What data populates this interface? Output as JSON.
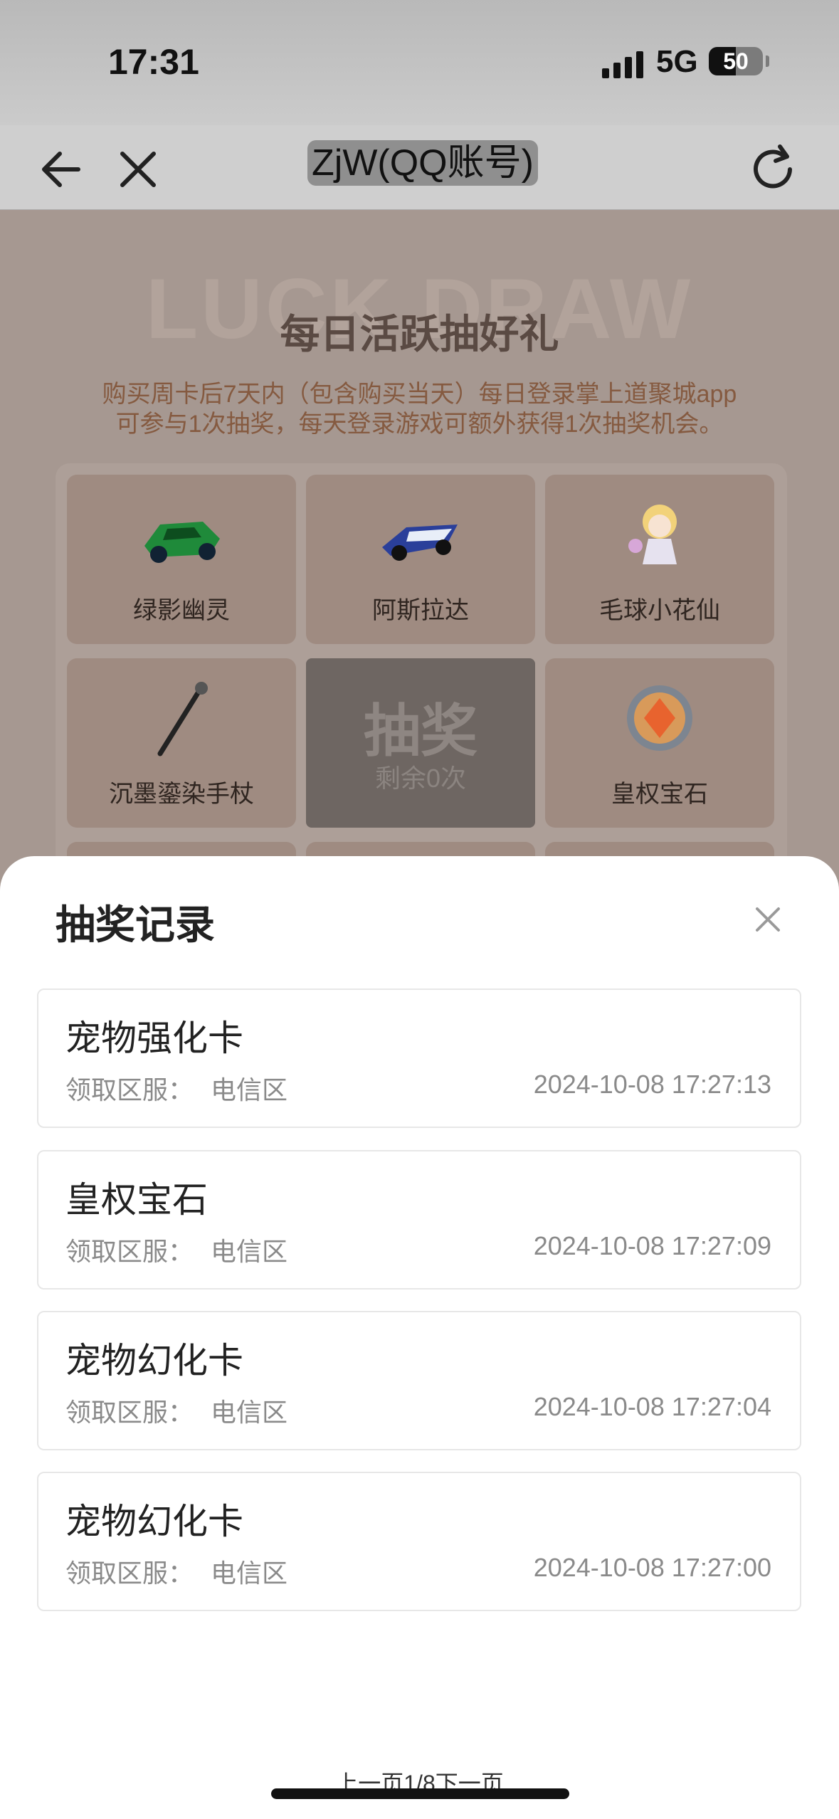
{
  "status": {
    "time": "17:31",
    "network": "5G",
    "battery": "50"
  },
  "nav": {
    "title": "ZjW(QQ账号)"
  },
  "event": {
    "bg_text": "LUCK DRAW",
    "title": "每日活跃抽好礼",
    "desc_line1": "购买周卡后7天内（包含购买当天）每日登录掌上道聚城app",
    "desc_line2": "可参与1次抽奖，每天登录游戏可额外获得1次抽奖机会。"
  },
  "prizes": [
    {
      "label": "绿影幽灵",
      "icon": "green-car-icon"
    },
    {
      "label": "阿斯拉达",
      "icon": "blue-car-icon"
    },
    {
      "label": "毛球小花仙",
      "icon": "fairy-icon"
    },
    {
      "label": "沉墨鎏染手杖",
      "icon": "staff-icon"
    },
    {
      "label": "皇权宝石",
      "icon": "gem-icon"
    }
  ],
  "draw": {
    "label": "抽奖",
    "remaining": "剩余0次"
  },
  "sheet": {
    "title": "抽奖记录",
    "records": [
      {
        "name": "宠物强化卡",
        "server_label": "领取区服：",
        "server": "电信区",
        "time": "2024-10-08 17:27:13"
      },
      {
        "name": "皇权宝石",
        "server_label": "领取区服：",
        "server": "电信区",
        "time": "2024-10-08 17:27:09"
      },
      {
        "name": "宠物幻化卡",
        "server_label": "领取区服：",
        "server": "电信区",
        "time": "2024-10-08 17:27:04"
      },
      {
        "name": "宠物幻化卡",
        "server_label": "领取区服：",
        "server": "电信区",
        "time": "2024-10-08 17:27:00"
      }
    ],
    "pager": {
      "prev": "上一页",
      "current": "1",
      "total": "/8",
      "next": "下一页"
    }
  },
  "colors": {
    "accent_text": "#855a40",
    "sheet_bg": "#ffffff",
    "overlay": "#a69891"
  }
}
